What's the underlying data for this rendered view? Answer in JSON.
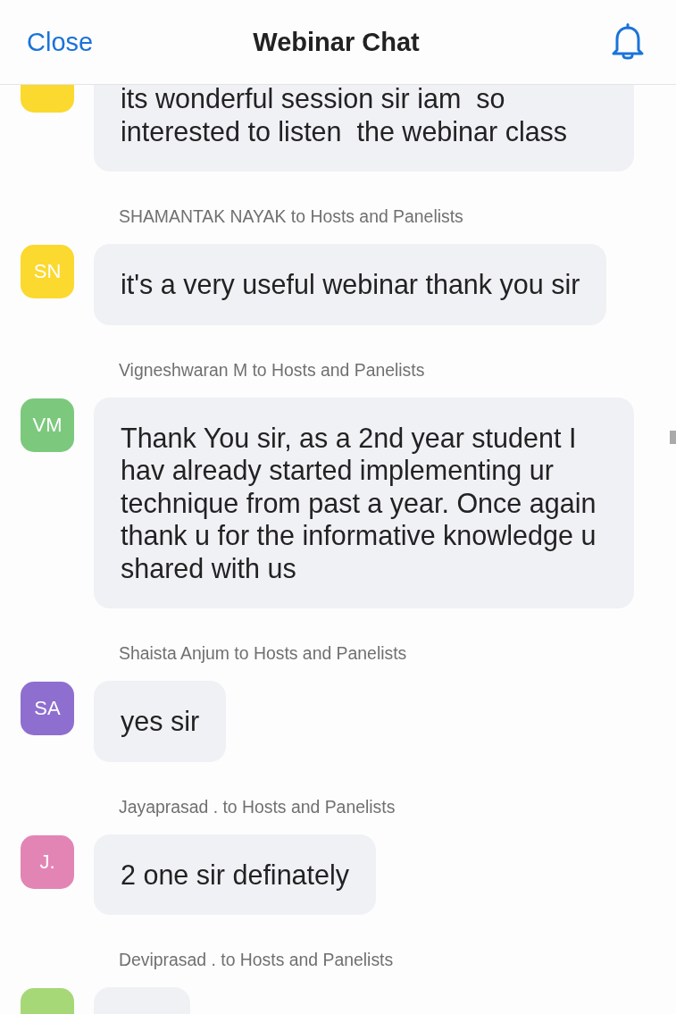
{
  "header": {
    "close": "Close",
    "title": "Webinar Chat"
  },
  "messages": [
    {
      "color": "#fbd92e",
      "text": "its wonderful session sir iam  so interested to listen  the webinar class"
    },
    {
      "sender": "SHAMANTAK NAYAK to Hosts and Panelists",
      "initials": "SN",
      "color": "#fbd92e",
      "text": "it's a very useful webinar thank you sir"
    },
    {
      "sender": "Vigneshwaran M to Hosts and Panelists",
      "initials": "VM",
      "color": "#7cc97e",
      "text": "Thank You sir, as a 2nd year student I hav already started implementing ur technique from past a year. Once again thank u for the informative knowledge u shared with us"
    },
    {
      "sender": "Shaista Anjum to Hosts and Panelists",
      "initials": "SA",
      "color": "#8e6fcf",
      "text": "yes sir"
    },
    {
      "sender": "Jayaprasad . to Hosts and Panelists",
      "initials": "J.",
      "color": "#e385b4",
      "text": "2 one sir definately"
    },
    {
      "sender": "Deviprasad . to Hosts and Panelists",
      "color": "#a6d878"
    }
  ]
}
